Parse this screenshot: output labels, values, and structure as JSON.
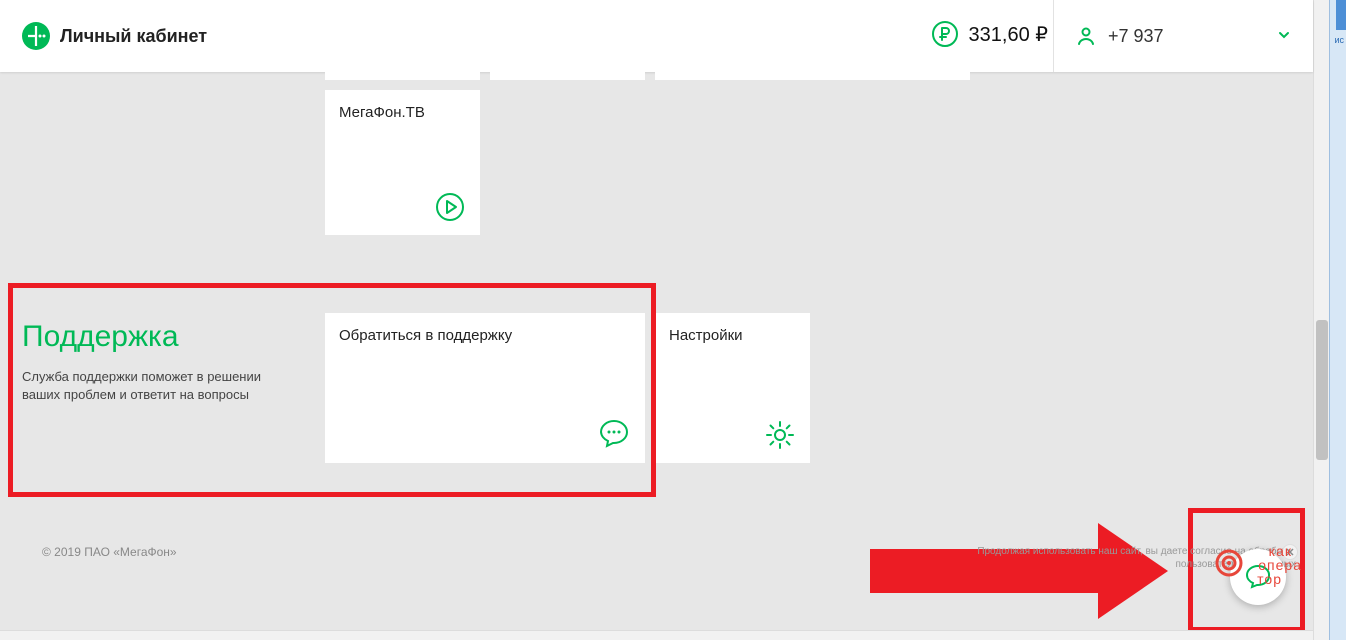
{
  "header": {
    "title": "Личный кабинет",
    "balance": "331,60 ₽",
    "phone": "+7 937"
  },
  "tiles": {
    "tv": {
      "title": "МегаФон.ТВ"
    }
  },
  "support": {
    "heading": "Поддержка",
    "desc": "Служба поддержки поможет в решении ваших проблем и ответит на вопросы",
    "contact_label": "Обратиться в поддержку",
    "settings_label": "Настройки"
  },
  "footer": {
    "copyright": "© 2019 ПАО «МегаФон»",
    "notice_l1": "Продолжая использовать наш сайт, вы даете согласие на обработку",
    "notice_l2": "пользовательских данных"
  },
  "watermark": {
    "l1": "как",
    "l2": "опера",
    "l3": "тор"
  },
  "blue_strip_text": "ис",
  "colors": {
    "accent": "#00b956",
    "highlight": "#ec1c24"
  }
}
